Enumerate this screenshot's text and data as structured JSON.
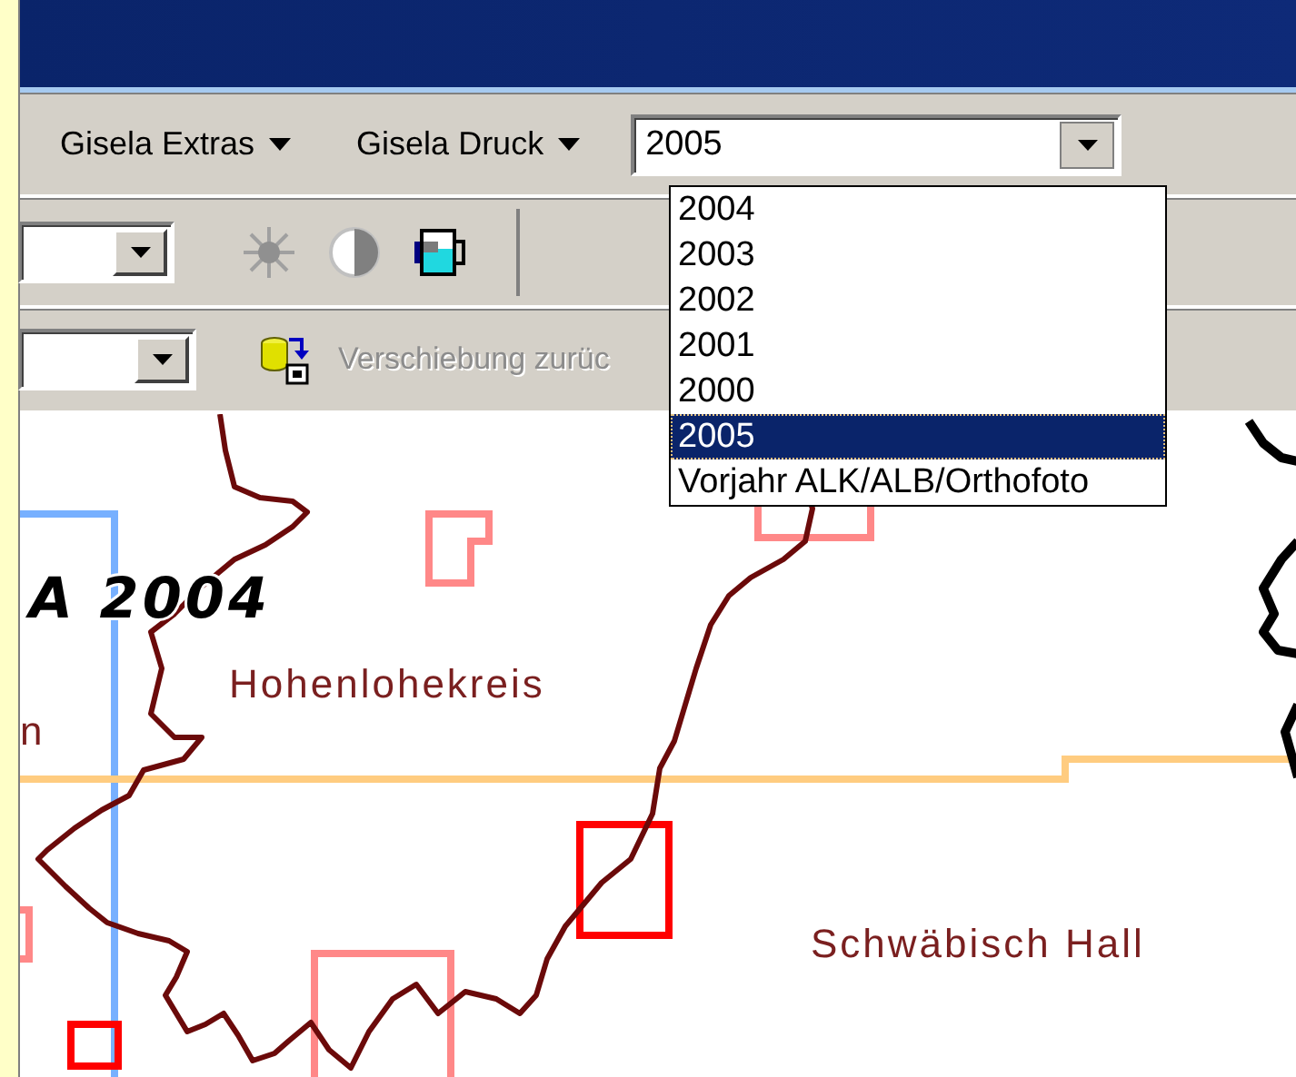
{
  "menus": [
    {
      "label": "Gisela Extras"
    },
    {
      "label": "Gisela Druck"
    }
  ],
  "year_combo": {
    "value": "2005",
    "expanded": true,
    "options": [
      {
        "label": "2004",
        "selected": false
      },
      {
        "label": "2003",
        "selected": false
      },
      {
        "label": "2002",
        "selected": false
      },
      {
        "label": "2001",
        "selected": false
      },
      {
        "label": "2000",
        "selected": false
      },
      {
        "label": "2005",
        "selected": true
      },
      {
        "label": "Vorjahr ALK/ALB/Orthofoto",
        "selected": false
      }
    ]
  },
  "toolbar_2": {
    "tools": [
      {
        "kind": "brightness"
      },
      {
        "kind": "contrast"
      },
      {
        "kind": "color"
      }
    ]
  },
  "toolbar_3": {
    "tool": {
      "label": "Verschiebung zurüc",
      "disabled": true
    }
  },
  "map": {
    "labels": [
      {
        "text": "A 2004",
        "kind": "title"
      },
      {
        "text": "Hohenlohekreis",
        "kind": "place"
      },
      {
        "text": "n",
        "kind": "place"
      },
      {
        "text": "Schwäbisch Hall",
        "kind": "place"
      }
    ]
  }
}
